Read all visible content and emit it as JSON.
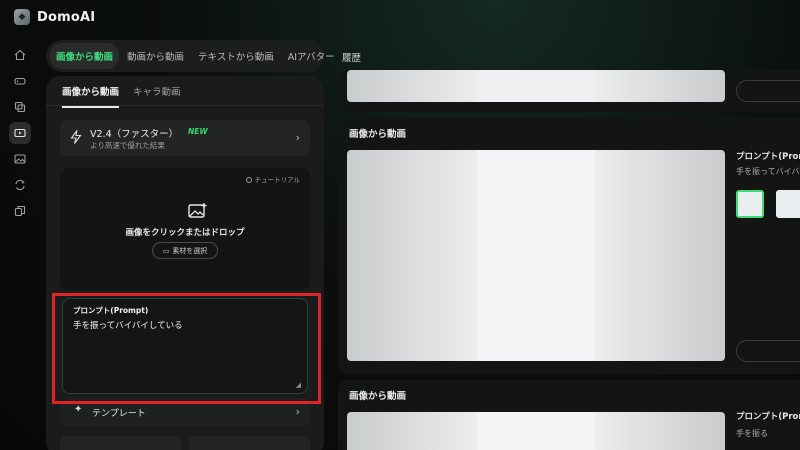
{
  "app": {
    "brand": "DomoAI"
  },
  "sidebar": {
    "items": [
      {
        "icon": "home-icon"
      },
      {
        "icon": "gamepad-icon"
      },
      {
        "icon": "layers-icon"
      },
      {
        "icon": "video-icon",
        "active": true
      },
      {
        "icon": "image-icon"
      },
      {
        "icon": "repeat-icon"
      },
      {
        "icon": "copy-icon"
      }
    ]
  },
  "mode_tabs": [
    {
      "label": "画像から動画",
      "active": true
    },
    {
      "label": "動画から動画"
    },
    {
      "label": "テキストから動画"
    },
    {
      "label": "AIアバター"
    }
  ],
  "panel": {
    "subtabs": [
      {
        "label": "画像から動画",
        "active": true
      },
      {
        "label": "キャラ動画"
      }
    ],
    "model": {
      "name": "V2.4（ファスター）",
      "badge": "NEW",
      "description": "より高速で優れた結果"
    },
    "upload": {
      "tutorial": "チュートリアル",
      "text": "画像をクリックまたはドロップ",
      "select_button": "素材を選択"
    },
    "prompt": {
      "label": "プロンプト(Prompt)",
      "value": "手を振ってバイバイしている"
    },
    "template": {
      "label": "テンプレート"
    }
  },
  "history": {
    "title": "履歴",
    "cards": [
      {
        "title": "画像から動画",
        "side_label": "プロンプト(Prom",
        "side_text": "手を振ってバイバ"
      },
      {
        "title": "画像から動画",
        "side_label": "プロンプト(Prom",
        "side_text": "手を振る"
      }
    ]
  },
  "colors": {
    "accent": "#3fdc7a",
    "highlight": "#e0232a"
  }
}
